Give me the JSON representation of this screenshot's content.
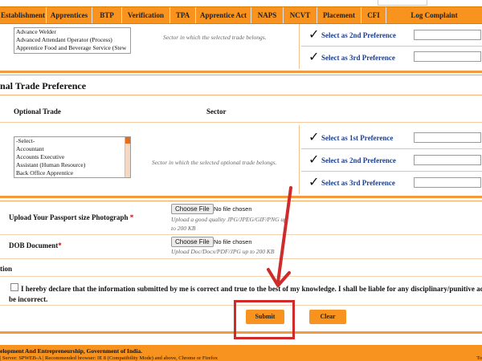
{
  "nav": {
    "items": [
      "Establishment",
      "Apprentices",
      "BTP",
      "Verification",
      "TPA",
      "Apprentice Act",
      "NAPS",
      "NCVT",
      "Placement",
      "CFI",
      "Log Complaint"
    ]
  },
  "trade": {
    "options": [
      "Advance Welder",
      "Advanced Attendant Operator (Process)",
      "Apprentice Food and Beverage Service (Stew"
    ],
    "sector_note": "Sector in which the selected trade belongs.",
    "pref2": "Select as 2nd Preference",
    "pref3": "Select as 3rd Preference"
  },
  "optional": {
    "section_title": "nal Trade Preference",
    "col_trade": "Optional Trade",
    "col_sector": "Sector",
    "options": [
      "-Select-",
      "Accountant",
      "Accounts Executive",
      "Assistant (Human Resource)",
      "Back Office Apprentice"
    ],
    "sector_note": "Sector in which the selected optional trade belongs.",
    "pref1": "Select as 1st Preference",
    "pref2": "Select as 2nd Preference",
    "pref3": "Select as 3rd Preference"
  },
  "upload": {
    "photo_label": "Upload Your Passport size Photograph",
    "photo_req": "*",
    "choose": "Choose File",
    "nofile": "No file chosen",
    "photo_hint1": "Upload a good quality JPG/JPEG/GIF/PNG up",
    "photo_hint2": "to 200 KB",
    "dob_label": "DOB Document",
    "dob_req": "*",
    "dob_hint1": "Upload Doc/Docx/PDF/JPG up to 200 KB"
  },
  "declaration": {
    "heading": "tion",
    "line1": "I hereby declare that the information submitted by me is correct and true to the best of my knowledge. I shall be liable for any disciplinary/punitive act",
    "line2": "be incorrect."
  },
  "actions": {
    "submit": "Submit",
    "clear": "Clear"
  },
  "footer": {
    "line1": "elopment And Entrepreneurship, Government of India.",
    "line2": "| Server: SPWEB-A | Recommended browser: IE 8 (Compatibility Mode) and above, Chrome or Firefox",
    "right": "To"
  },
  "colors": {
    "accent": "#f7931e",
    "annotation_red": "#cf2b2b",
    "pref_blue": "#1d3f8f"
  }
}
